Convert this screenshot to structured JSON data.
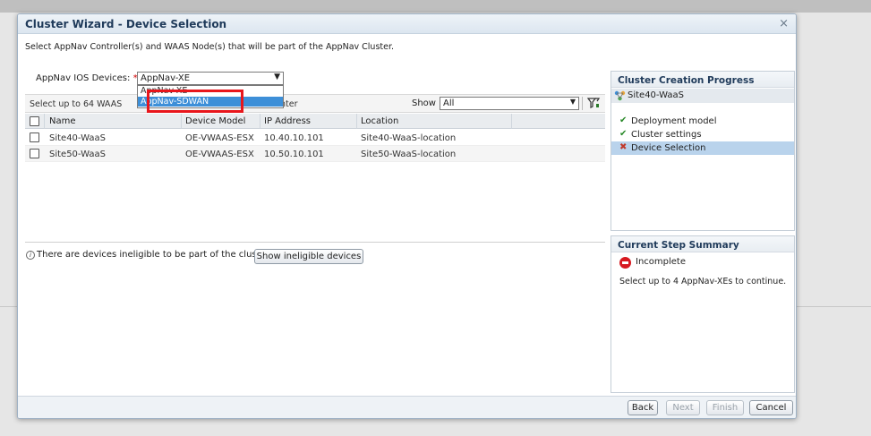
{
  "dialog": {
    "title": "Cluster Wizard - Device Selection",
    "close_glyph": "×",
    "instruction": "Select AppNav Controller(s) and WAAS Node(s) that will be part of the AppNav Cluster."
  },
  "device_type": {
    "label": "AppNav IOS Devices:",
    "required_mark": "*",
    "selected": "AppNav-XE",
    "options": [
      "AppNav-XE",
      "AppNav-SDWAN"
    ],
    "highlighted_option": "AppNav-SDWAN"
  },
  "grid_toolbar": {
    "select_text": "Select up to 64 WAAS",
    "select_text_tail": "nter",
    "show_label": "Show",
    "show_value": "All",
    "filter_icon": "filter-icon"
  },
  "table": {
    "columns": [
      "Name",
      "Device Model",
      "IP Address",
      "Location"
    ],
    "rows": [
      {
        "name": "Site40-WaaS",
        "model": "OE-VWAAS-ESX",
        "ip": "10.40.10.101",
        "location": "Site40-WaaS-location"
      },
      {
        "name": "Site50-WaaS",
        "model": "OE-VWAAS-ESX",
        "ip": "10.50.10.101",
        "location": "Site50-WaaS-location"
      }
    ]
  },
  "ineligible": {
    "message": "There are devices ineligible to be part of the cluster.",
    "button": "Show ineligible devices"
  },
  "progress": {
    "title": "Cluster Creation Progress",
    "cluster_name": "Site40-WaaS",
    "steps": [
      {
        "label": "Deployment model",
        "status": "done"
      },
      {
        "label": "Cluster settings",
        "status": "done"
      },
      {
        "label": "Device Selection",
        "status": "current"
      }
    ]
  },
  "summary": {
    "title": "Current Step Summary",
    "status": "Incomplete",
    "message": "Select up to 4 AppNav-XEs to continue."
  },
  "footer": {
    "back": "Back",
    "next": "Next",
    "finish": "Finish",
    "cancel": "Cancel"
  },
  "colors": {
    "highlight": "#3d8fd8",
    "annotation_red": "#e8161c",
    "active_step": "#b9d3ec",
    "title_text": "#1f3a5a"
  }
}
